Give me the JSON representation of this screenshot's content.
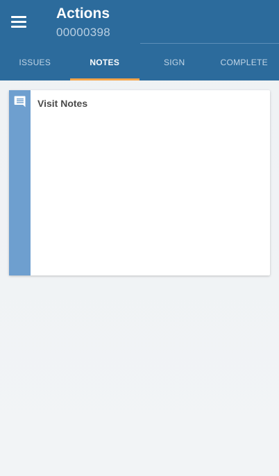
{
  "header": {
    "title": "Actions",
    "subtitle": "00000398",
    "menu_icon": "hamburger-menu-icon"
  },
  "tabs": [
    {
      "label": "ISSUES",
      "active": false
    },
    {
      "label": "NOTES",
      "active": true
    },
    {
      "label": "SIGN",
      "active": false
    },
    {
      "label": "COMPLETE",
      "active": false
    }
  ],
  "notes_card": {
    "title": "Visit Notes",
    "icon": "comment-icon",
    "content": ""
  },
  "colors": {
    "header_bg": "#2c6b9c",
    "active_tab_indicator": "#f5a54a",
    "card_accent": "#6e9fcf",
    "page_bg": "#eef1f4"
  }
}
